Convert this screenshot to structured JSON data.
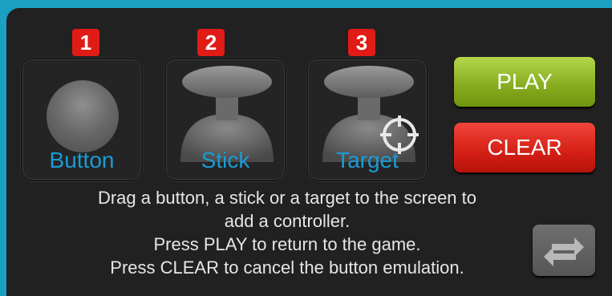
{
  "tiles": [
    {
      "badge": "1",
      "label": "Button"
    },
    {
      "badge": "2",
      "label": "Stick"
    },
    {
      "badge": "3",
      "label": "Target"
    }
  ],
  "icons": {
    "button": "ball-icon",
    "stick": "joystick-icon",
    "target": "joystick-icon",
    "crosshair": "crosshair-icon",
    "swap": "swap-arrows-icon"
  },
  "buttons": {
    "play": "PLAY",
    "clear": "CLEAR"
  },
  "instructions": [
    "Drag a button, a stick or a target to the screen to",
    "add a controller.",
    "Press PLAY to return to the game.",
    "Press CLEAR to cancel the button emulation."
  ],
  "colors": {
    "frame": "#1ba0c4",
    "panel": "#212121",
    "badge": "#e11b15",
    "label": "#1a9bd6",
    "play": "#86ab1e",
    "clear": "#d41f16"
  }
}
